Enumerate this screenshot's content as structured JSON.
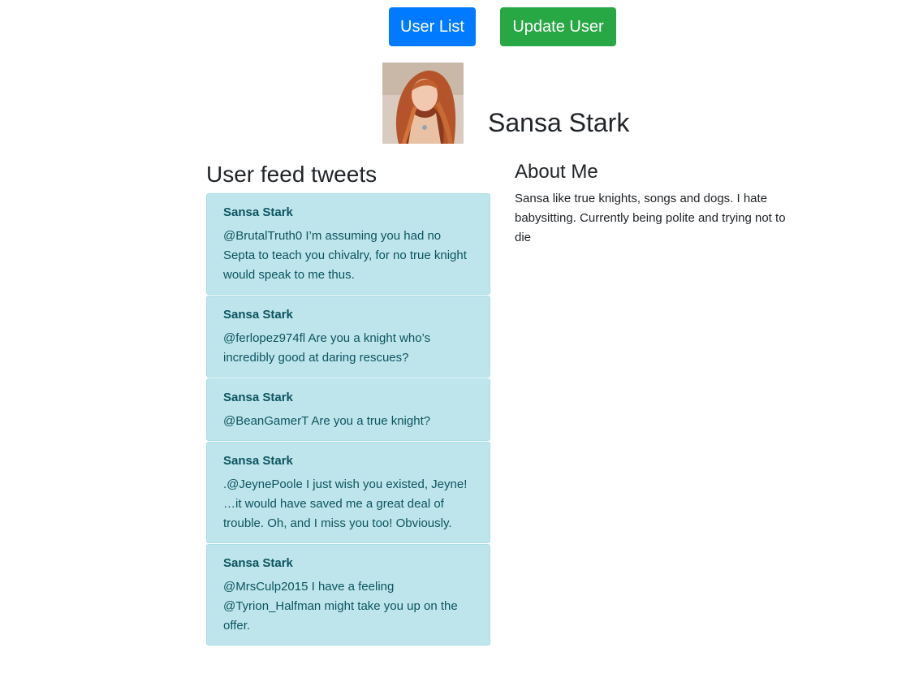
{
  "header": {
    "user_list_label": "User List",
    "update_user_label": "Update User"
  },
  "profile": {
    "name": "Sansa Stark",
    "avatar_alt": "Sansa Stark"
  },
  "feed": {
    "title": "User feed tweets",
    "tweets": [
      {
        "author": "Sansa Stark",
        "text": "@BrutalTruth0 I’m assuming you had no Septa to teach you chivalry, for no true knight would speak to me thus."
      },
      {
        "author": "Sansa Stark",
        "text": "@ferlopez974fl Are you a knight who’s incredibly good at daring rescues?"
      },
      {
        "author": "Sansa Stark",
        "text": "@BeanGamerT Are you a true knight?"
      },
      {
        "author": "Sansa Stark",
        "text": ".@JeynePoole I just wish you existed, Jeyne! …it would have saved me a great deal of trouble. Oh, and I miss you too! Obviously."
      },
      {
        "author": "Sansa Stark",
        "text": "@MrsCulp2015 I have a feeling @Tyrion_Halfman might take you up on the offer."
      }
    ]
  },
  "about": {
    "title": "About Me",
    "text": "Sansa like true knights, songs and dogs. I hate babysitting. Currently being polite and trying not to die"
  },
  "colors": {
    "primary": "#007bff",
    "success": "#28a745",
    "tweet_bg": "#bee5eb",
    "tweet_text": "#0c5460"
  }
}
